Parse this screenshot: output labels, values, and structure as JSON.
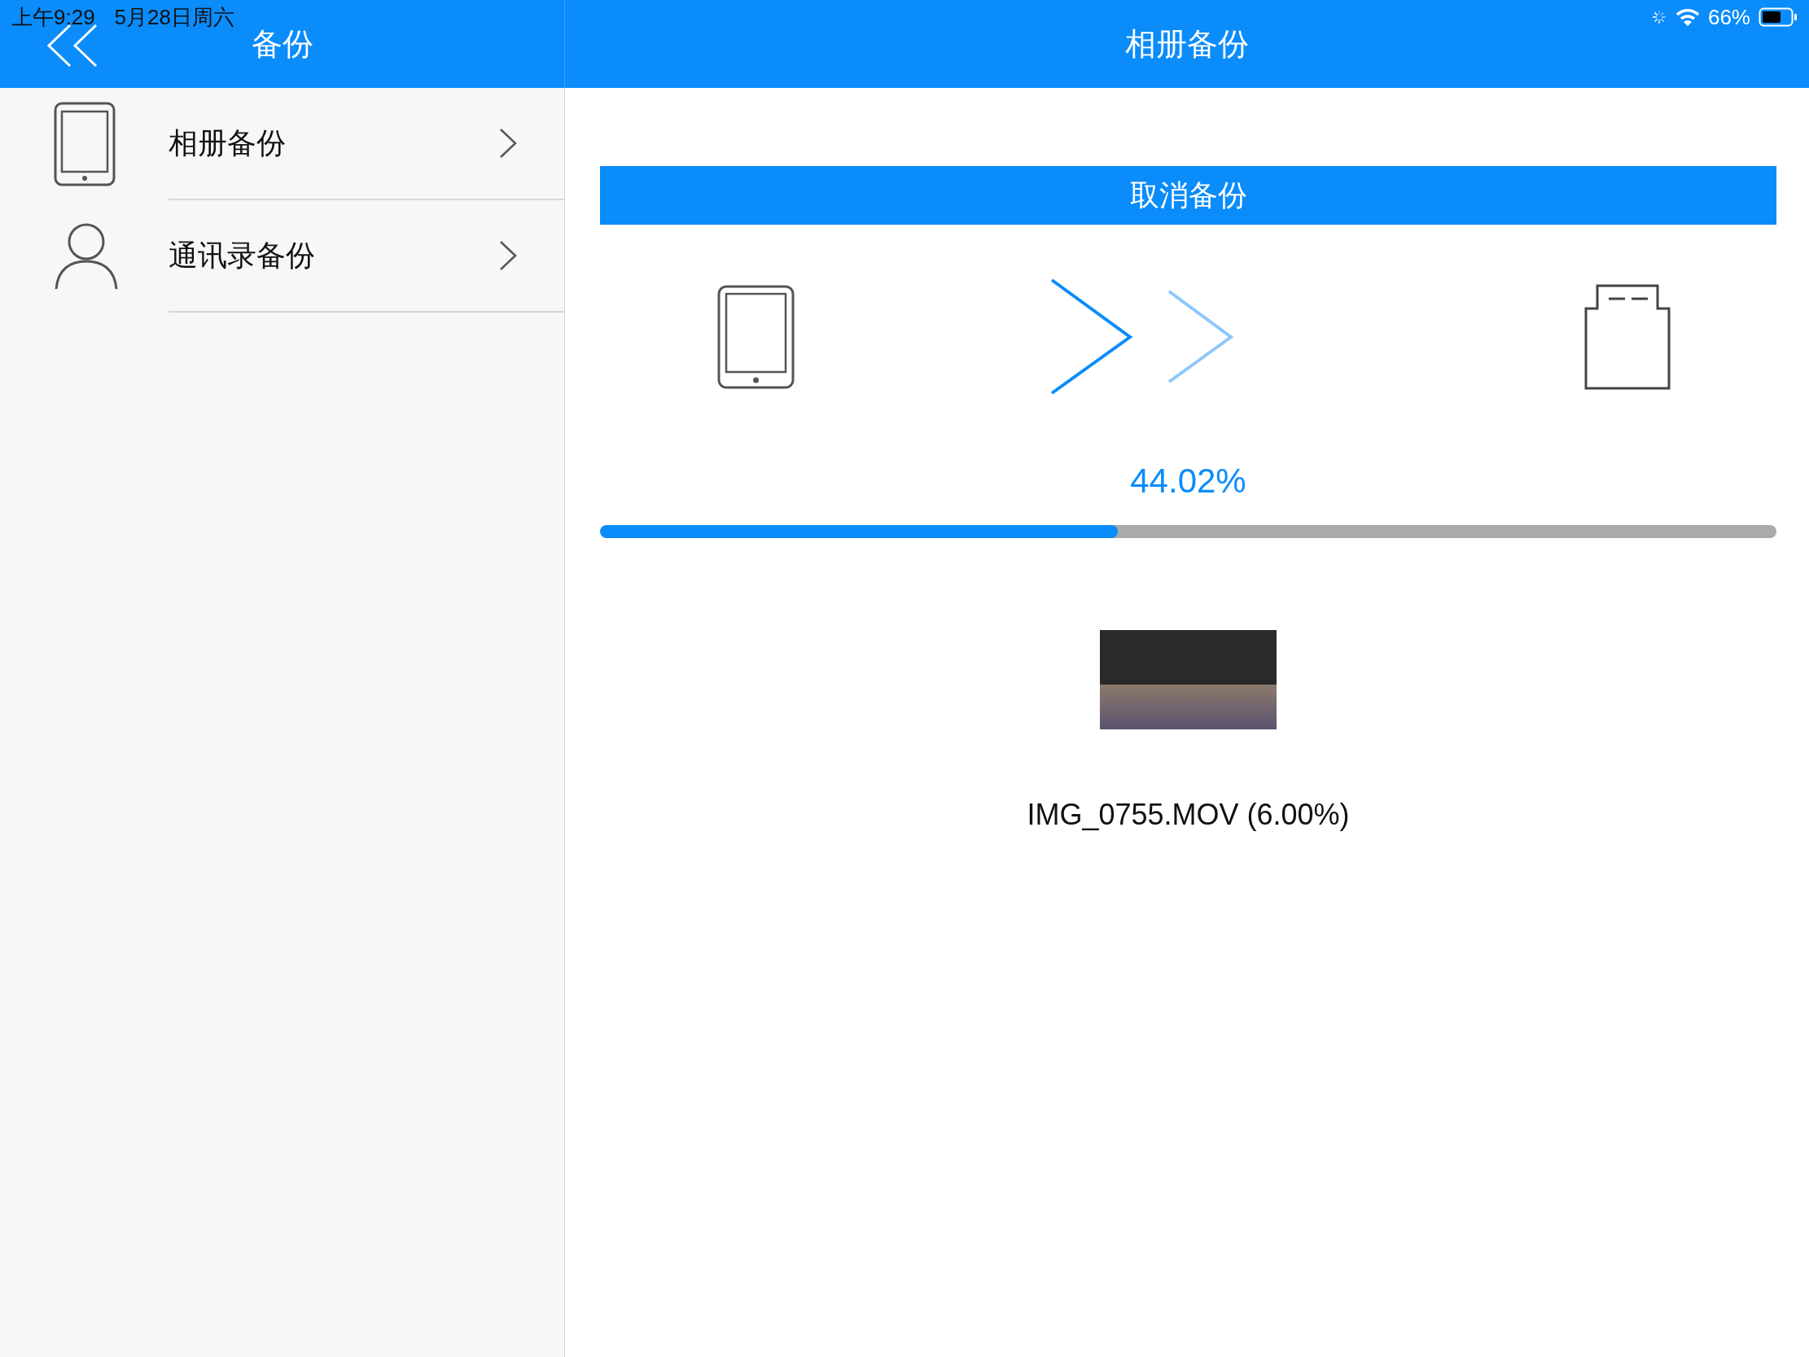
{
  "status_bar": {
    "time": "上午9:29",
    "date": "5月28日周六",
    "battery": "66%"
  },
  "sidebar": {
    "title": "备份",
    "items": [
      {
        "label": "相册备份",
        "kind": "tablet"
      },
      {
        "label": "通讯录备份",
        "kind": "person"
      }
    ]
  },
  "main": {
    "title": "相册备份",
    "cancel_button": "取消备份",
    "progress": {
      "reading": "44.02%",
      "level": 0.4402
    },
    "current_file": {
      "name": "IMG_0755.MOV (6.00%)"
    }
  }
}
